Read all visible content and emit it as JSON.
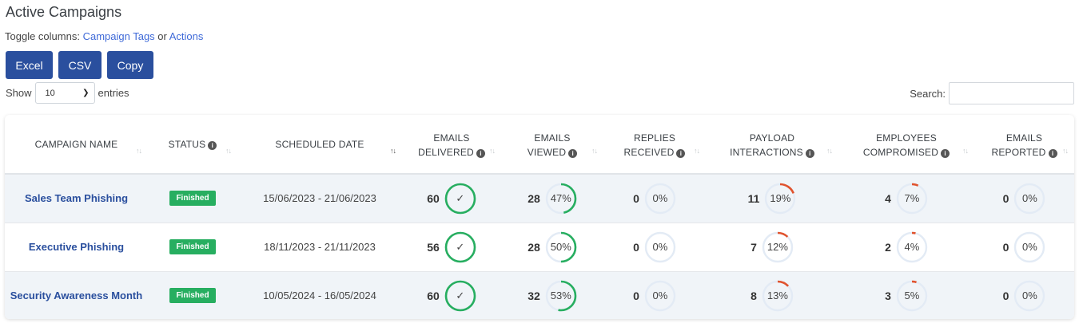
{
  "title": "Active Campaigns",
  "toggle": {
    "prefix": "Toggle columns:",
    "link_tags": "Campaign Tags",
    "or": "or",
    "link_actions": "Actions"
  },
  "buttons": {
    "excel": "Excel",
    "csv": "CSV",
    "copy": "Copy"
  },
  "length": {
    "show": "Show",
    "value": "10",
    "entries": "entries"
  },
  "search": {
    "label": "Search:",
    "value": ""
  },
  "colors": {
    "green": "#27ae60",
    "red": "#e0532e",
    "track": "#e3ebf5",
    "brand": "#2a4f9e"
  },
  "columns": [
    {
      "line1": "",
      "line2": "Campaign Name",
      "info": false,
      "sorted": false
    },
    {
      "line1": "",
      "line2": "Status",
      "info": true,
      "sorted": false
    },
    {
      "line1": "",
      "line2": "Scheduled Date",
      "info": false,
      "sorted": true
    },
    {
      "line1": "Emails",
      "line2": "Delivered",
      "info": true,
      "sorted": false
    },
    {
      "line1": "Emails",
      "line2": "Viewed",
      "info": true,
      "sorted": false
    },
    {
      "line1": "Replies",
      "line2": "Received",
      "info": true,
      "sorted": false
    },
    {
      "line1": "Payload",
      "line2": "Interactions",
      "info": true,
      "sorted": false
    },
    {
      "line1": "Employees",
      "line2": "Compromised",
      "info": true,
      "sorted": false
    },
    {
      "line1": "Emails",
      "line2": "Reported",
      "info": true,
      "sorted": false
    }
  ],
  "rows": [
    {
      "name": "Sales Team Phishing",
      "status": "Finished",
      "date": "15/06/2023 - 21/06/2023",
      "delivered": {
        "value": "60",
        "label": "✓",
        "pct": 100,
        "tone": "green"
      },
      "viewed": {
        "value": "28",
        "label": "47%",
        "pct": 47,
        "tone": "green"
      },
      "replies": {
        "value": "0",
        "label": "0%",
        "pct": 0,
        "tone": "green"
      },
      "payload": {
        "value": "11",
        "label": "19%",
        "pct": 19,
        "tone": "red"
      },
      "compromised": {
        "value": "4",
        "label": "7%",
        "pct": 7,
        "tone": "red"
      },
      "reported": {
        "value": "0",
        "label": "0%",
        "pct": 0,
        "tone": "green"
      }
    },
    {
      "name": "Executive Phishing",
      "status": "Finished",
      "date": "18/11/2023 - 21/11/2023",
      "delivered": {
        "value": "56",
        "label": "✓",
        "pct": 100,
        "tone": "green"
      },
      "viewed": {
        "value": "28",
        "label": "50%",
        "pct": 50,
        "tone": "green"
      },
      "replies": {
        "value": "0",
        "label": "0%",
        "pct": 0,
        "tone": "green"
      },
      "payload": {
        "value": "7",
        "label": "12%",
        "pct": 12,
        "tone": "red"
      },
      "compromised": {
        "value": "2",
        "label": "4%",
        "pct": 4,
        "tone": "red"
      },
      "reported": {
        "value": "0",
        "label": "0%",
        "pct": 0,
        "tone": "green"
      }
    },
    {
      "name": "Security Awareness Month",
      "status": "Finished",
      "date": "10/05/2024 - 16/05/2024",
      "delivered": {
        "value": "60",
        "label": "✓",
        "pct": 100,
        "tone": "green"
      },
      "viewed": {
        "value": "32",
        "label": "53%",
        "pct": 53,
        "tone": "green"
      },
      "replies": {
        "value": "0",
        "label": "0%",
        "pct": 0,
        "tone": "green"
      },
      "payload": {
        "value": "8",
        "label": "13%",
        "pct": 13,
        "tone": "red"
      },
      "compromised": {
        "value": "3",
        "label": "5%",
        "pct": 5,
        "tone": "red"
      },
      "reported": {
        "value": "0",
        "label": "0%",
        "pct": 0,
        "tone": "green"
      }
    }
  ]
}
